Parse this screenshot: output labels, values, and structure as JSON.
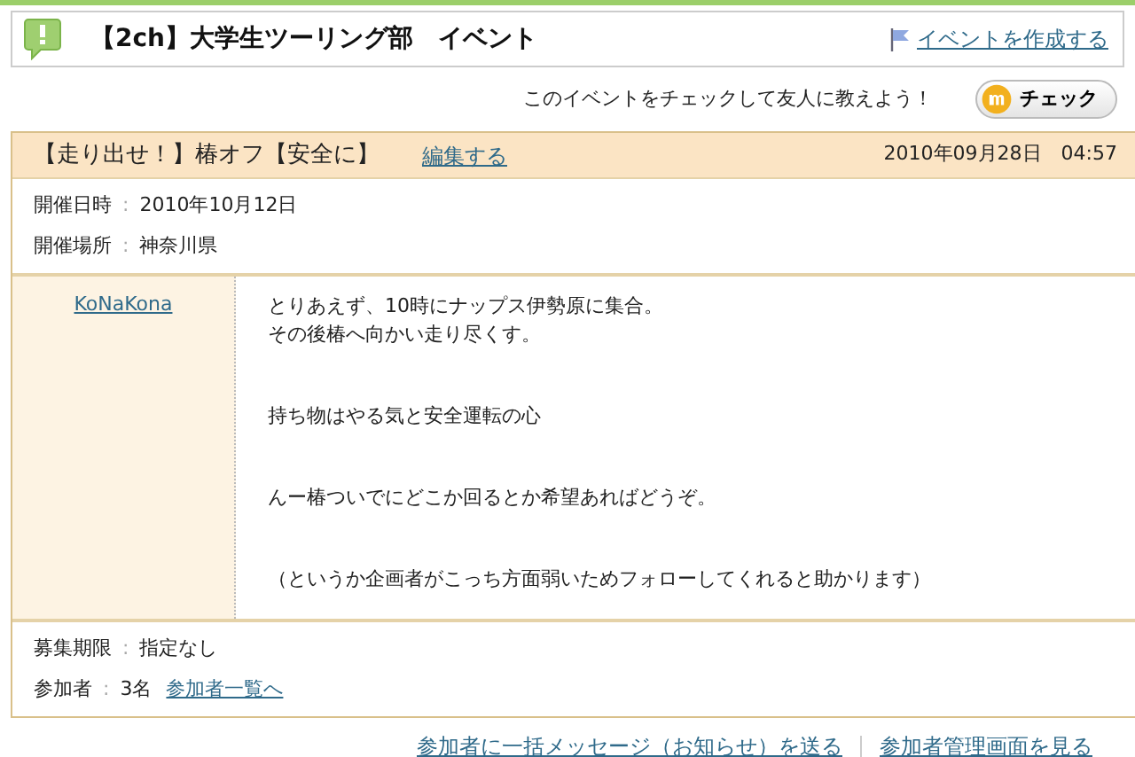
{
  "header": {
    "title": "【2ch】大学生ツーリング部　イベント",
    "create_link": "イベントを作成する"
  },
  "check_bar": {
    "prompt": "このイベントをチェックして友人に教えよう！",
    "button": "チェック"
  },
  "event": {
    "title": "【走り出せ！】椿オフ【安全に】",
    "edit_link": "編集する",
    "posted": "2010年09月28日　04:57",
    "info": [
      {
        "label": "開催日時",
        "separator": ":",
        "value": "2010年10月12日"
      },
      {
        "label": "開催場所",
        "separator": ":",
        "value": "神奈川県"
      }
    ],
    "author": "KoNaKona",
    "paragraphs": [
      [
        "とりあえず、10時にナップス伊勢原に集合。",
        "その後椿へ向かい走り尽くす。"
      ],
      [
        "持ち物はやる気と安全運転の心"
      ],
      [
        "んー椿ついでにどこか回るとか希望あればどうぞ。"
      ],
      [
        "（というか企画者がこっち方面弱いためフォローしてくれると助かります）"
      ]
    ],
    "deadline": {
      "label": "募集期限",
      "separator": ":",
      "value": "指定なし"
    },
    "participants": {
      "label": "参加者",
      "separator": ":",
      "value": "3名",
      "link": "参加者一覧へ"
    }
  },
  "footer_links": [
    "参加者に一括メッセージ（お知らせ）を送る",
    "参加者管理画面を見る"
  ]
}
